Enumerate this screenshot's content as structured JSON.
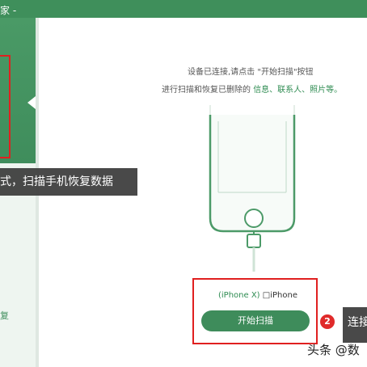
{
  "window": {
    "title_fragment": "家 -"
  },
  "sidebar": {
    "tooltip_text": "式，扫描手机恢复数据",
    "bottom_label": "复"
  },
  "instruction": {
    "line1": "设备已连接,请点击 \"开始扫描\"按钮",
    "line2_prefix": "进行扫描和恢复已删除的",
    "line2_links": "信息、联系人、照片等。"
  },
  "device": {
    "model": "(iPhone X)",
    "name": "□iPhone"
  },
  "scan_button": {
    "label": "开始扫描"
  },
  "step_badge": {
    "number": "2"
  },
  "right_tip": {
    "text": "连接点击"
  },
  "watermark": {
    "text": "头条 @数"
  },
  "colors": {
    "brand_green": "#3f8f5b",
    "highlight_green": "#2f8c52",
    "annotation_red": "#e02020"
  },
  "icons": {
    "phone": "phone-outline-icon"
  }
}
